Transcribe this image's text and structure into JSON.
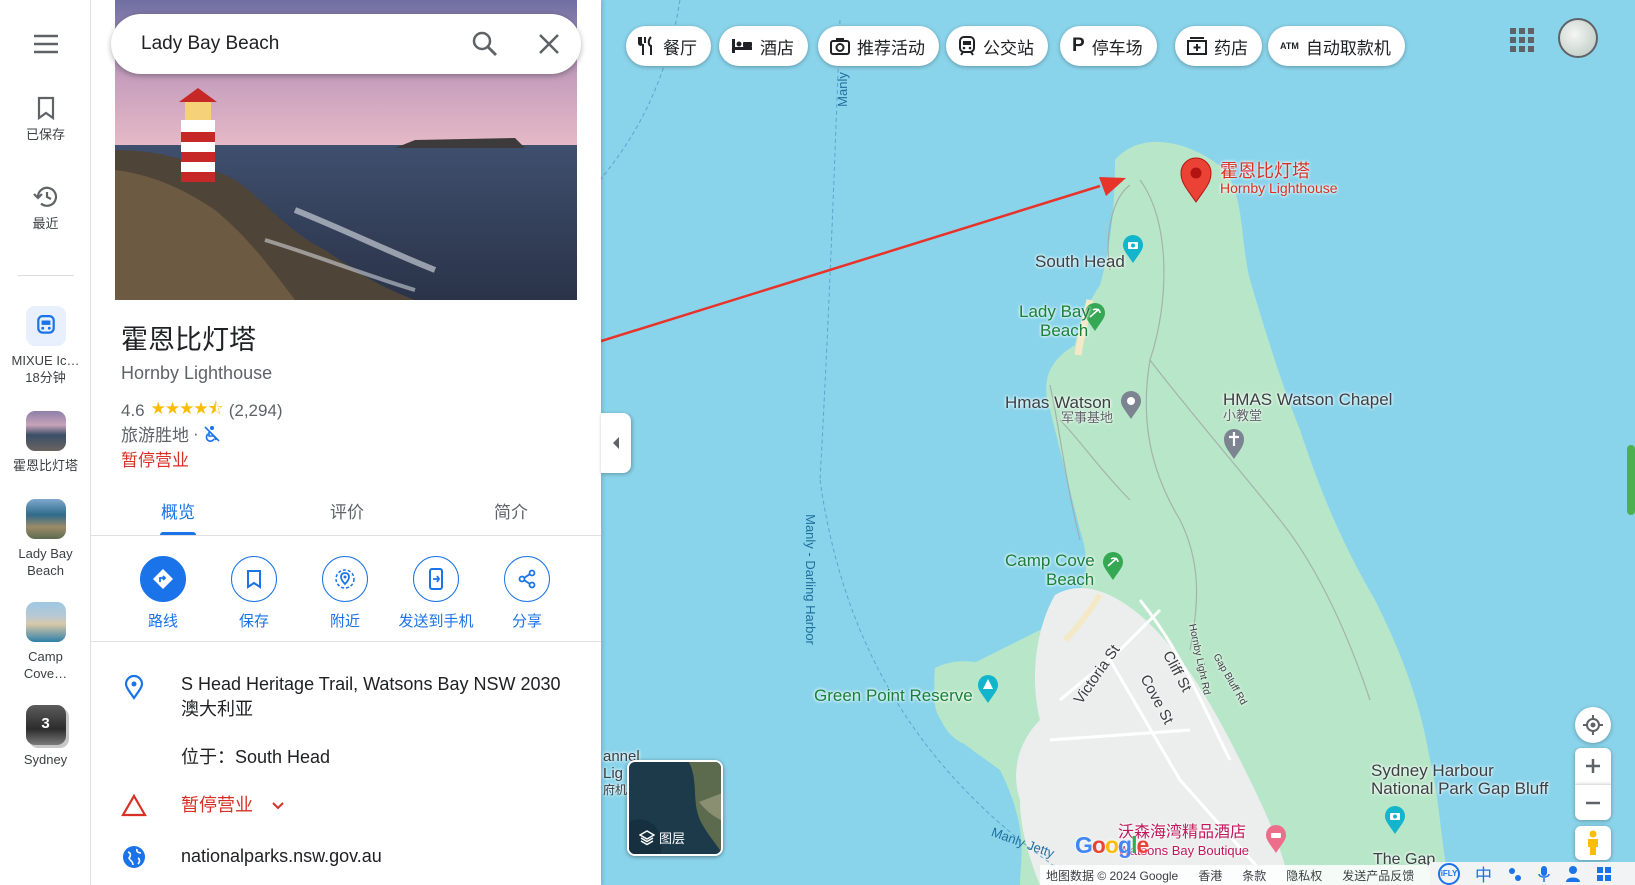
{
  "search": {
    "value": "Lady Bay Beach",
    "search_icon": "search-icon",
    "close_icon": "close-icon"
  },
  "rail": {
    "menu_icon": "menu-icon",
    "saved_label": "已保存",
    "recent_label": "最近",
    "recents": [
      {
        "label": "MIXUE Ic…",
        "sub": "18分钟",
        "icon": "bus-icon"
      },
      {
        "label": "霍恩比灯塔",
        "sub": ""
      },
      {
        "label": "Lady Bay",
        "sub": "Beach"
      },
      {
        "label": "Camp",
        "sub": "Cove…"
      },
      {
        "label": "Sydney",
        "sub": "",
        "badge": "3"
      }
    ]
  },
  "place": {
    "title": "霍恩比灯塔",
    "subtitle": "Hornby Lighthouse",
    "rating": "4.6",
    "stars": "★★★★⯪",
    "star_fraction": 0.92,
    "review_count": "(2,294)",
    "category": "旅游胜地",
    "category_sep": "·",
    "accessibility_icon": "no-wheelchair-icon",
    "status": "暂停营业"
  },
  "tabs": [
    {
      "label": "概览",
      "active": true
    },
    {
      "label": "评价",
      "active": false
    },
    {
      "label": "简介",
      "active": false
    }
  ],
  "actions": [
    {
      "label": "路线",
      "icon": "directions-icon"
    },
    {
      "label": "保存",
      "icon": "bookmark-icon"
    },
    {
      "label": "附近",
      "icon": "nearby-icon"
    },
    {
      "label": "发送到手机",
      "icon": "send-to-phone-icon"
    },
    {
      "label": "分享",
      "icon": "share-icon"
    }
  ],
  "info": {
    "address": "S Head Heritage Trail, Watsons Bay NSW 2030澳大利亚",
    "located_in": "位于：South Head",
    "status": "暂停营业",
    "website": "nationalparks.nsw.gov.au"
  },
  "chips": [
    {
      "label": "餐厅",
      "icon": "restaurant-icon"
    },
    {
      "label": "酒店",
      "icon": "hotel-icon"
    },
    {
      "label": "推荐活动",
      "icon": "camera-icon"
    },
    {
      "label": "公交站",
      "icon": "transit-icon"
    },
    {
      "label": "停车场",
      "icon": "parking-icon"
    },
    {
      "label": "药店",
      "icon": "pharmacy-icon"
    },
    {
      "label": "自动取款机",
      "icon": "atm-icon"
    }
  ],
  "map": {
    "pin_name": "霍恩比灯塔",
    "pin_sub": "Hornby Lighthouse",
    "labels": {
      "south_head": "South Head",
      "lady_bay_1": "Lady Bay",
      "lady_bay_2": "Beach",
      "hmas_watson": "Hmas Watson",
      "hmas_watson_sub": "军事基地",
      "hmas_chapel": "HMAS Watson Chapel",
      "hmas_chapel_sub": "小教堂",
      "camp_cove_1": "Camp Cove",
      "camp_cove_2": "Beach",
      "green_point": "Green Point Reserve",
      "victoria_st": "Victoria St",
      "cliff_st": "Cliff St",
      "cove_st": "Cove St",
      "hornby_light_rd": "Hornby Light Rd",
      "gap_bluff_rd": "Gap Bluff Rd",
      "manly_darling": "Manly - Darling Harbor",
      "manly_top": "Manly",
      "manly_jetty": "Manly Jetty",
      "sydney_harbour_1": "Sydney Harbour",
      "sydney_harbour_2": "National Park Gap Bluff",
      "watsons_bay_cn": "沃森海湾精品酒店",
      "watsons_bay_en": "Watsons Bay Boutique",
      "the_gap": "The Gap",
      "channel_1": "annel",
      "channel_2": "Lig",
      "channel_3": "府机"
    },
    "layers_label": "图层",
    "google_logo": "Google",
    "attribution": [
      "地图数据 © 2024 Google",
      "香港",
      "条款",
      "隐私权",
      "发送产品反馈"
    ],
    "ime": {
      "badge": "iFLY",
      "lang": "中"
    },
    "colors": {
      "water": "#8ad4eb",
      "park": "#b8e6c8",
      "urban": "#eceeee",
      "pin": "#ea4335",
      "arrow": "#e8332a",
      "accent": "#1a73e8",
      "closed": "#d93025"
    }
  }
}
